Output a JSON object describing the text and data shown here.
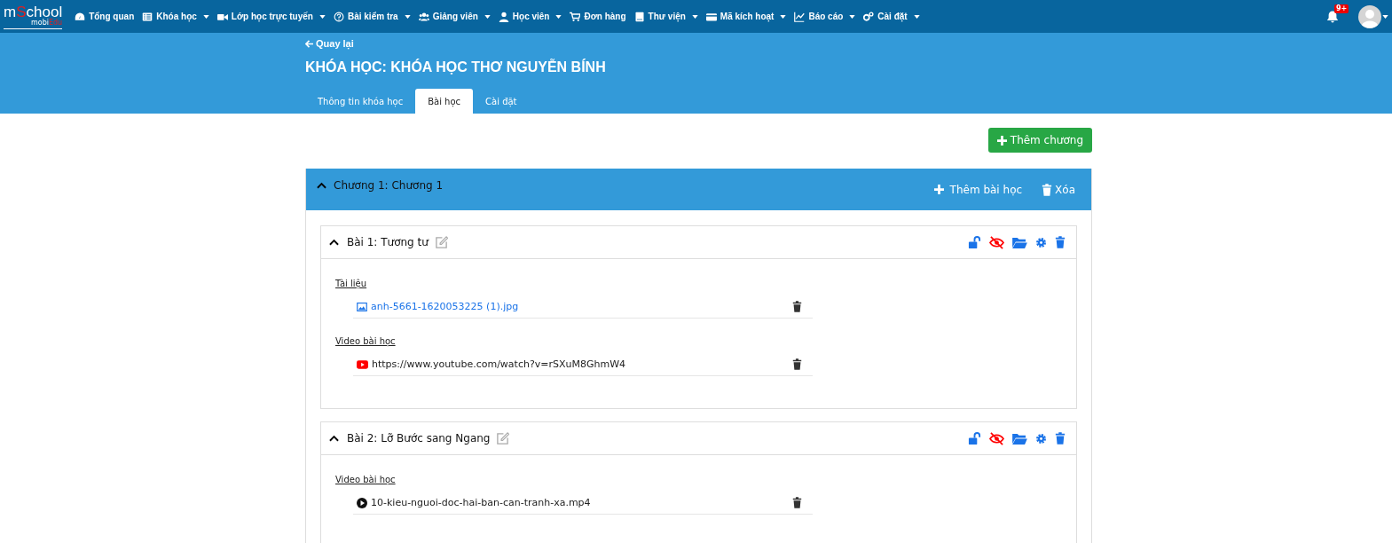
{
  "logo": {
    "main_start": "m",
    "main_accent": "S",
    "main_end": "chool",
    "sub_start": "mobi",
    "sub_accent": "Edu"
  },
  "nav": [
    {
      "label": "Tổng quan",
      "caret": false
    },
    {
      "label": "Khóa học",
      "caret": true
    },
    {
      "label": "Lớp học trực tuyến",
      "caret": true
    },
    {
      "label": "Bài kiểm tra",
      "caret": true
    },
    {
      "label": "Giảng viên",
      "caret": true
    },
    {
      "label": "Học viên",
      "caret": true
    },
    {
      "label": "Đơn hàng",
      "caret": false
    },
    {
      "label": "Thư viện",
      "caret": true
    },
    {
      "label": "Mã kích hoạt",
      "caret": true
    },
    {
      "label": "Báo cáo",
      "caret": true
    },
    {
      "label": "Cài đặt",
      "caret": true
    }
  ],
  "notifications": {
    "badge": "9+"
  },
  "header": {
    "back": "Quay lại",
    "title": "KHÓA HỌC: KHÓA HỌC THƠ NGUYỄN BÍNH"
  },
  "tabs": [
    {
      "label": "Thông tin khóa học",
      "selected": false
    },
    {
      "label": "Bài học",
      "selected": true
    },
    {
      "label": "Cài đặt",
      "selected": false
    }
  ],
  "add_chapter": "Thêm chương",
  "chapter": {
    "title": "Chương 1: Chương 1",
    "expanded": true,
    "add_lesson": "Thêm bài học",
    "delete": "Xóa"
  },
  "lessons": [
    {
      "title": "Bài 1: Tương tư",
      "expanded": true,
      "locked": false,
      "visible": false,
      "sections": [
        {
          "heading": "Tài liệu",
          "items": [
            {
              "kind": "image",
              "text": "anh-5661-1620053225 (1).jpg"
            }
          ]
        },
        {
          "heading": "Video bài học",
          "items": [
            {
              "kind": "youtube",
              "text": "https://www.youtube.com/watch?v=rSXuM8GhmW4"
            }
          ]
        }
      ]
    },
    {
      "title": "Bài 2: Lỡ Bước sang Ngang",
      "expanded": true,
      "locked": false,
      "visible": false,
      "sections": [
        {
          "heading": "Video bài học",
          "items": [
            {
              "kind": "video",
              "text": "10-kieu-nguoi-doc-hai-ban-can-tranh-xa.mp4"
            }
          ]
        }
      ]
    }
  ]
}
